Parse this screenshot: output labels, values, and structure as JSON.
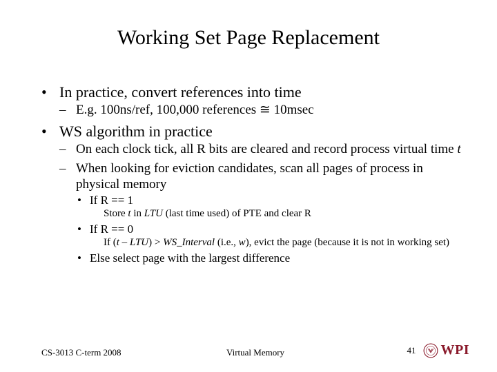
{
  "title": "Working Set Page Replacement",
  "b1": {
    "0": {
      "text": "In practice, convert references into time",
      "sub": {
        "0": "E.g. 100ns/ref, 100,000 references ≅ 10msec"
      }
    },
    "1": {
      "text": "WS algorithm in practice",
      "sub": {
        "0": "On each clock tick, all R bits are cleared and record process virtual time ",
        "0_ital": "t",
        "1": "When looking for eviction candidates, scan all pages of process in physical memory",
        "l3": {
          "0": "If R == 1",
          "0_sub_a": "Store ",
          "0_sub_b": "t",
          "0_sub_c": " in ",
          "0_sub_d": "LTU",
          "0_sub_e": " (last time used) of PTE and clear R",
          "1": "If R == 0",
          "1_sub_a": "If (",
          "1_sub_b": "t – LTU",
          "1_sub_c": ") > ",
          "1_sub_d": "WS_Interval",
          "1_sub_e": " (i.e., ",
          "1_sub_f": "w",
          "1_sub_g": "), evict the page (because it is not in working set)",
          "2": "Else select page with the largest difference"
        }
      }
    }
  },
  "footer": {
    "left": "CS-3013 C-term 2008",
    "center": "Virtual Memory",
    "page": "41",
    "logo_text": "WPI"
  }
}
